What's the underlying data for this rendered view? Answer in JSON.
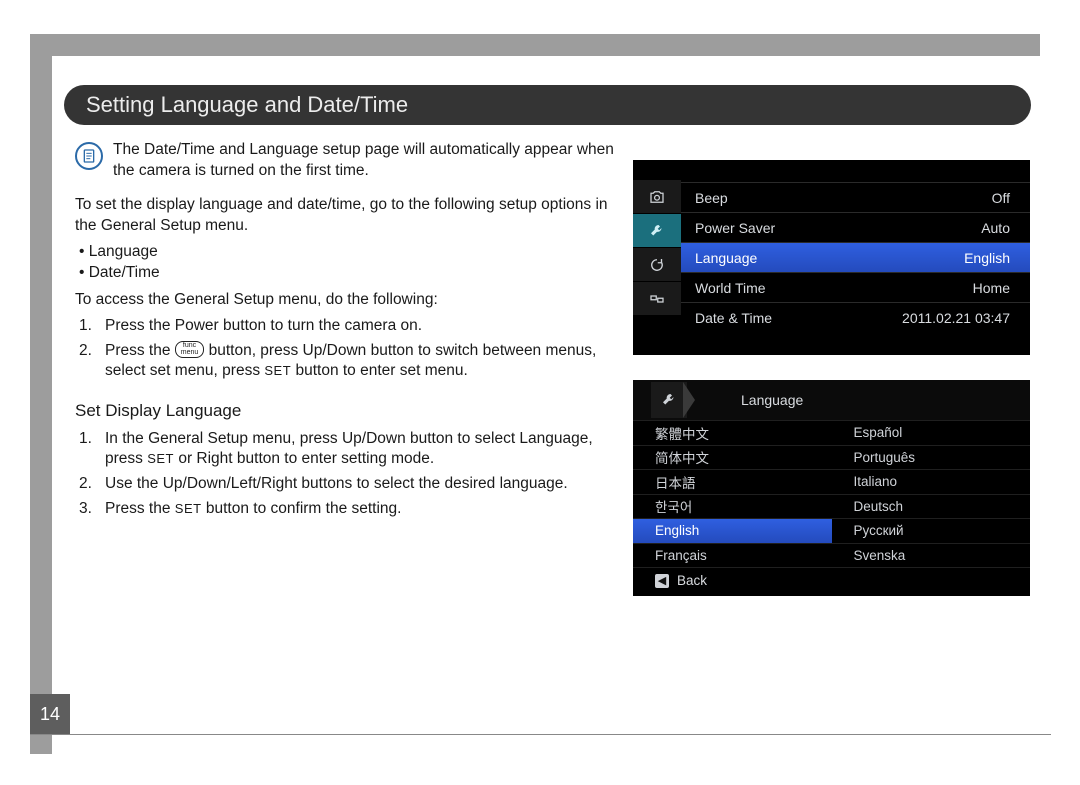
{
  "page_number": "14",
  "heading": "Setting Language and Date/Time",
  "note_text": "The Date/Time and Language setup page will automatically appear when the camera is turned on the first time.",
  "intro": "To set the display language and date/time, go to the following setup options in the General Setup menu.",
  "bullets": [
    "Language",
    "Date/Time"
  ],
  "access_intro": "To access the General Setup menu, do the following:",
  "access_steps": [
    {
      "n": "1.",
      "text": "Press the Power button to turn the camera on."
    },
    {
      "n": "2.",
      "pre": "Press the ",
      "func_top": "func",
      "func_bot": "menu",
      "mid": " button, press Up/Down button to switch between menus, select set menu, press ",
      "set": "SET",
      "post": " button to enter set menu."
    }
  ],
  "subhead": "Set Display Language",
  "lang_steps": [
    {
      "n": "1.",
      "pre": "In the General Setup menu, press Up/Down button to select Language, press ",
      "set": "SET",
      "post": " or Right button to enter setting mode."
    },
    {
      "n": "2.",
      "text": "Use the Up/Down/Left/Right buttons to select the desired language."
    },
    {
      "n": "3.",
      "pre": "Press the ",
      "set": "SET",
      "post": " button to confirm the setting."
    }
  ],
  "screenshot_a": {
    "rows": [
      {
        "label": "Beep",
        "value": "Off",
        "sel": false
      },
      {
        "label": "Power Saver",
        "value": "Auto",
        "sel": false
      },
      {
        "label": "Language",
        "value": "English",
        "sel": true
      },
      {
        "label": "World Time",
        "value": "Home",
        "sel": false
      },
      {
        "label": "Date & Time",
        "value": "2011.02.21 03:47",
        "sel": false
      }
    ]
  },
  "screenshot_b": {
    "title": "Language",
    "back": "Back",
    "langs_left": [
      "繁體中文",
      "简体中文",
      "日本語",
      "한국어",
      "English",
      "Français"
    ],
    "langs_right": [
      "Español",
      "Português",
      "Italiano",
      "Deutsch",
      "Русский",
      "Svenska"
    ],
    "selected": "English"
  }
}
